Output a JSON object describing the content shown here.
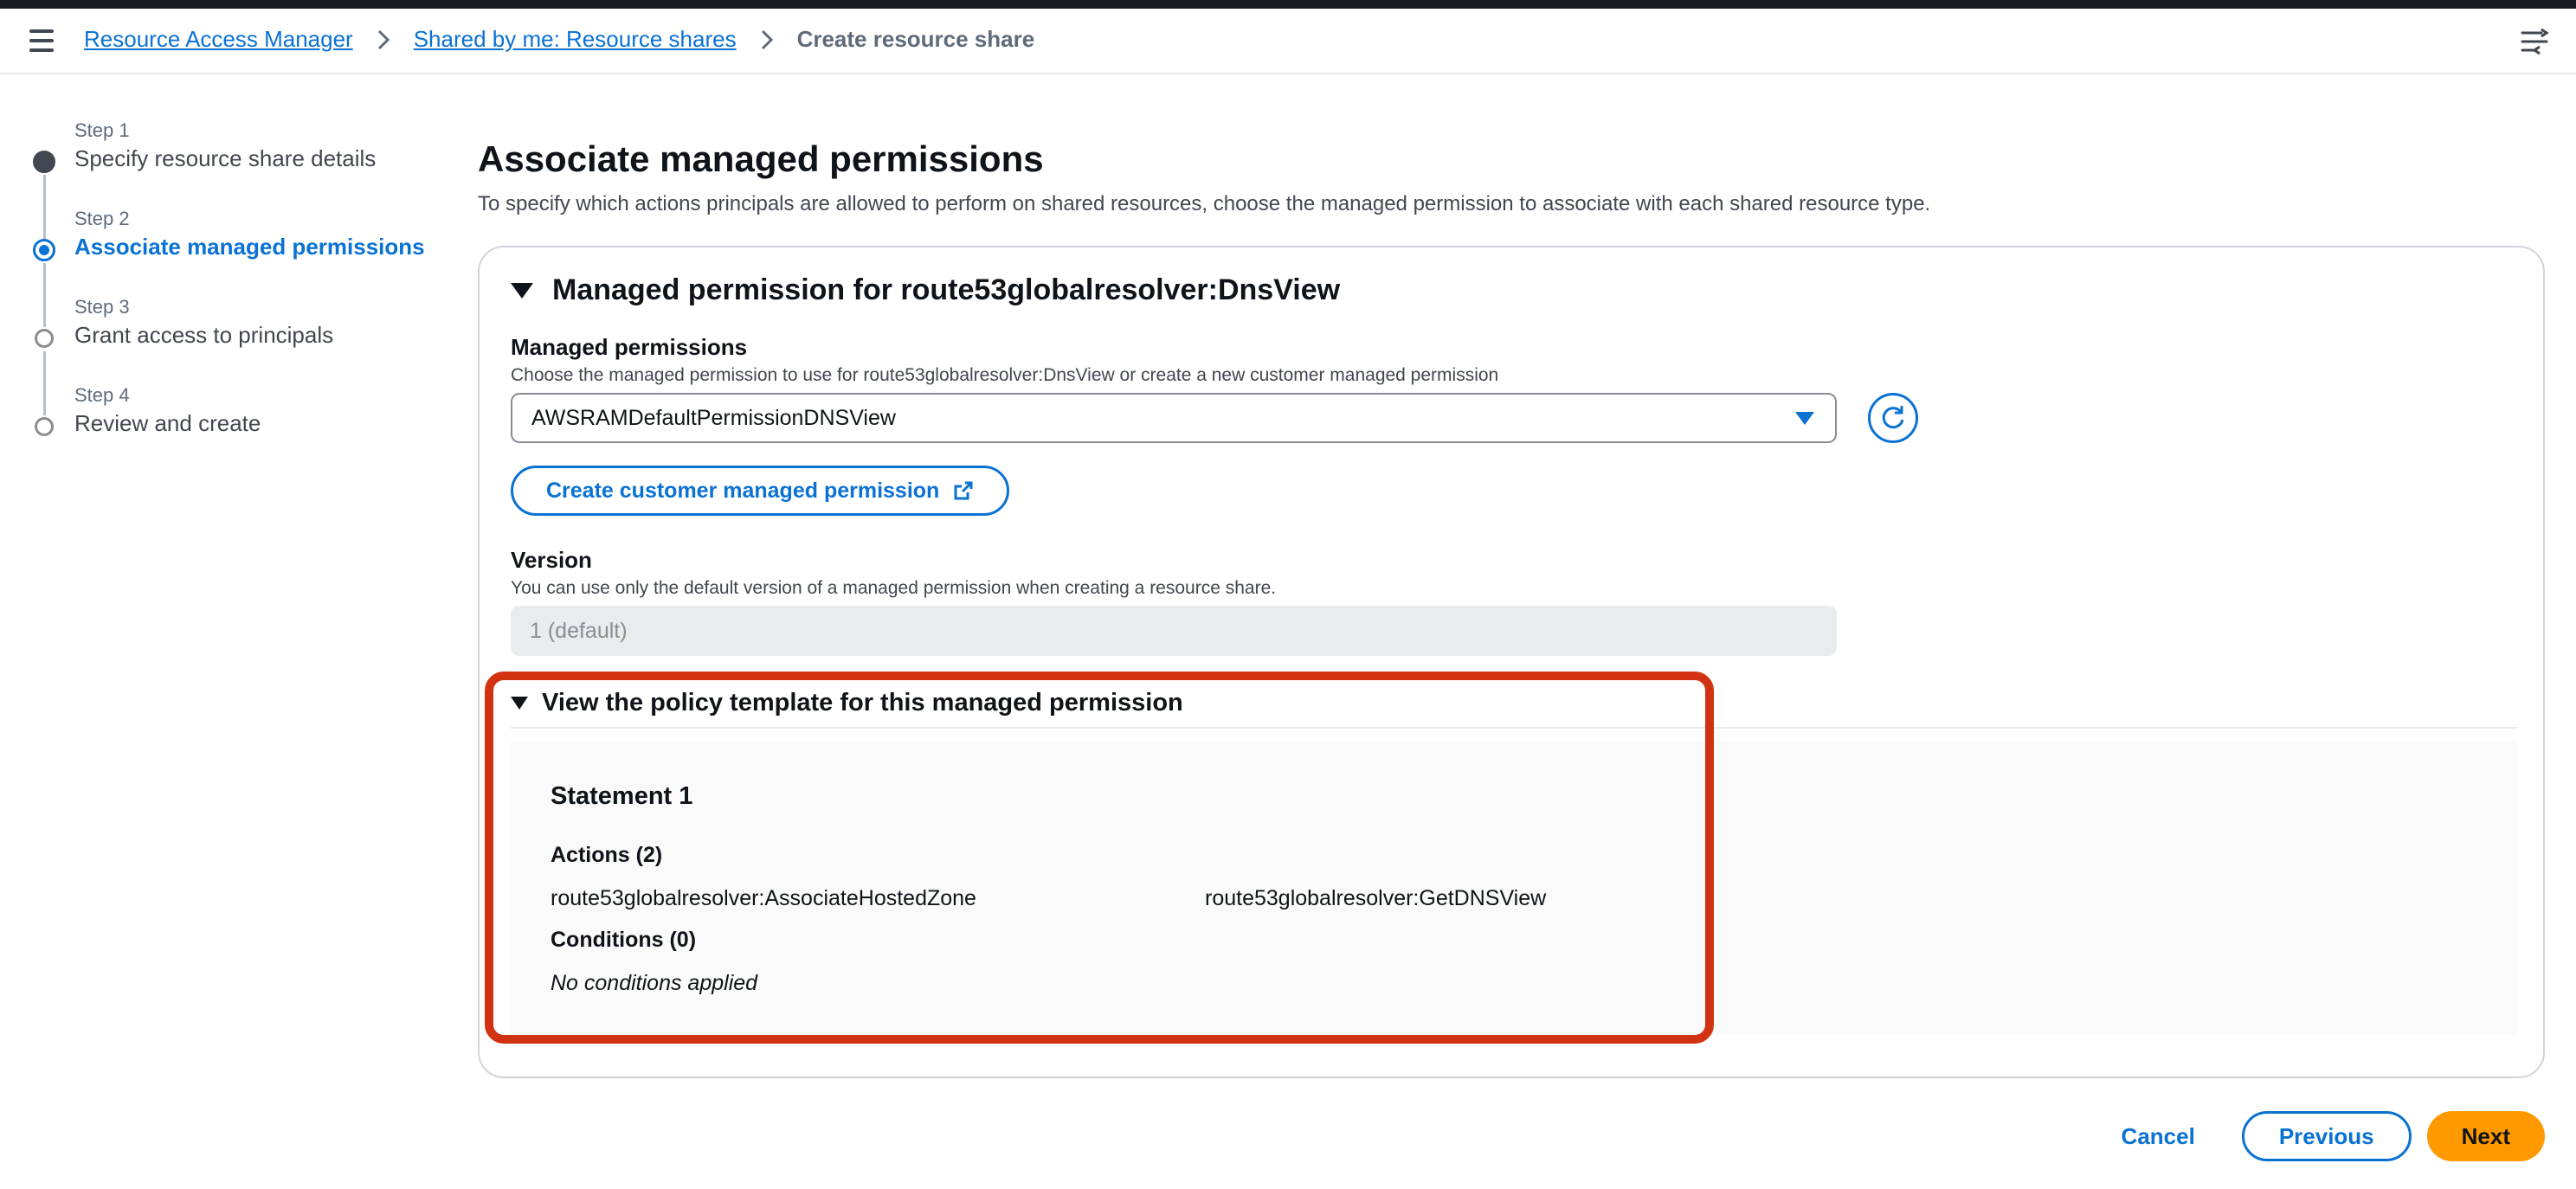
{
  "breadcrumb": {
    "items": [
      "Resource Access Manager",
      "Shared by me: Resource shares"
    ],
    "current": "Create resource share"
  },
  "steps": [
    {
      "num": "Step 1",
      "title": "Specify resource share details",
      "state": "done"
    },
    {
      "num": "Step 2",
      "title": "Associate managed permissions",
      "state": "active"
    },
    {
      "num": "Step 3",
      "title": "Grant access to principals",
      "state": "todo"
    },
    {
      "num": "Step 4",
      "title": "Review and create",
      "state": "todo"
    }
  ],
  "page": {
    "title": "Associate managed permissions",
    "description": "To specify which actions principals are allowed to perform on shared resources, choose the managed permission to associate with each shared resource type."
  },
  "section": {
    "title": "Managed permission for route53globalresolver:DnsView",
    "managed_permissions_label": "Managed permissions",
    "managed_permissions_desc": "Choose the managed permission to use for route53globalresolver:DnsView or create a new customer managed permission",
    "selected_permission": "AWSRAMDefaultPermissionDNSView",
    "create_button": "Create customer managed permission",
    "version_label": "Version",
    "version_desc": "You can use only the default version of a managed permission when creating a resource share.",
    "version_value": "1 (default)"
  },
  "policy": {
    "toggle_label": "View the policy template for this managed permission",
    "statement_title": "Statement 1",
    "actions_label": "Actions (2)",
    "actions": [
      "route53globalresolver:AssociateHostedZone",
      "route53globalresolver:GetDNSView"
    ],
    "conditions_label": "Conditions (0)",
    "no_conditions": "No conditions applied"
  },
  "footer": {
    "cancel": "Cancel",
    "previous": "Previous",
    "next": "Next"
  },
  "colors": {
    "accent": "#0972d3",
    "primary_button": "#ff9900",
    "highlight": "#d13212"
  },
  "icons": [
    "menu-icon",
    "chevron-right-icon",
    "split-panel-icon",
    "caret-down-icon",
    "refresh-icon",
    "external-link-icon",
    "step-dot-icon"
  ]
}
